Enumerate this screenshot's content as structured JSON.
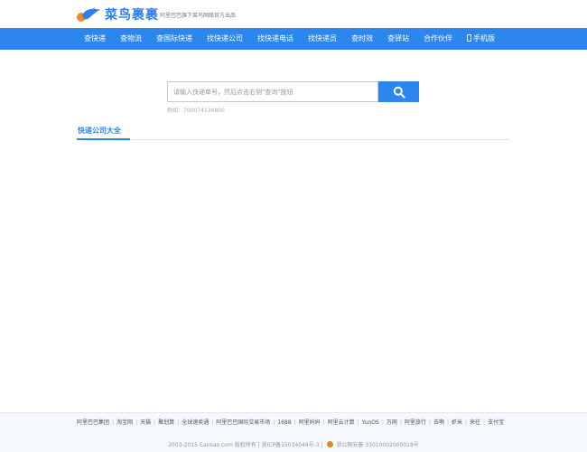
{
  "header": {
    "logo_text": "菜鸟裹裹",
    "tagline": "阿里巴巴旗下菜鸟网络官方出品"
  },
  "nav": {
    "items": [
      {
        "label": "查快递"
      },
      {
        "label": "查物流"
      },
      {
        "label": "查国际快递"
      },
      {
        "label": "找快递公司"
      },
      {
        "label": "找快递电话"
      },
      {
        "label": "找快递员"
      },
      {
        "label": "查时效"
      },
      {
        "label": "查驿站"
      },
      {
        "label": "合作伙伴"
      },
      {
        "label": "手机版"
      }
    ]
  },
  "search": {
    "placeholder": "请输入快递单号，然后点击右侧\"查询\"按钮",
    "example": "例如：700074134800"
  },
  "section": {
    "tab_label": "快递公司大全"
  },
  "footer": {
    "links": [
      "阿里巴巴集团",
      "淘宝网",
      "天猫",
      "聚划算",
      "全球速卖通",
      "阿里巴巴国际交易市场",
      "1688",
      "阿里妈妈",
      "阿里云计算",
      "YunOS",
      "万网",
      "阿里旅行",
      "去啊",
      "虾米",
      "来往",
      "支付宝"
    ],
    "copyright_left": "2003-2015 Cainiao.com 版权所有 | 浙ICP备15034046号-3 |",
    "copyright_right": "浙公网安备 33010002000018号"
  },
  "colors": {
    "brand_blue": "#2d86ee",
    "footer_bg": "#f5f8fc"
  }
}
